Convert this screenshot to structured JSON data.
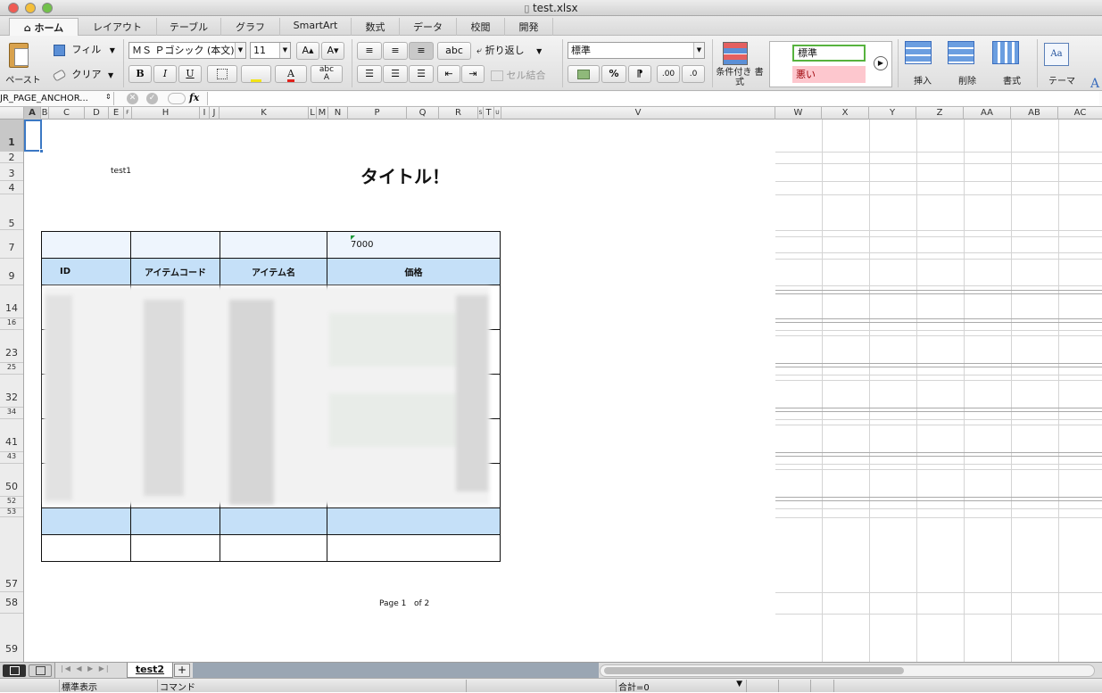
{
  "window": {
    "title": "test.xlsx"
  },
  "tabs": [
    "ホーム",
    "レイアウト",
    "テーブル",
    "グラフ",
    "SmartArt",
    "数式",
    "データ",
    "校閲",
    "開発"
  ],
  "ribbon": {
    "paste": "ペースト",
    "fill": "フィル",
    "clear": "クリア",
    "font_name": "ＭＳ Ｐゴシック (本文)",
    "font_size": "11",
    "bold": "B",
    "italic": "I",
    "underline": "U",
    "font_color_glyph": "A",
    "wrap": "折り返し",
    "merge": "セル結合",
    "abc": "abc",
    "number_format": "標準",
    "percent": "%",
    "comma": "⁋",
    "dec_inc": ".00",
    "dec_dec": ".0",
    "cond_format": "条件付き 書式",
    "style_normal": "標準",
    "style_bad": "悪い",
    "insert": "挿入",
    "delete": "削除",
    "format": "書式",
    "theme": "テーマ"
  },
  "formula_bar": {
    "name_box": "JR_PAGE_ANCHOR...",
    "fx": "fx",
    "value": ""
  },
  "columns": [
    "A",
    "B",
    "C",
    "D",
    "E",
    "F",
    "H",
    "I",
    "J",
    "K",
    "L",
    "M",
    "N",
    "P",
    "Q",
    "R",
    "S",
    "T",
    "U",
    "V",
    "W",
    "X",
    "Y",
    "Z",
    "AA",
    "AB",
    "AC"
  ],
  "rows": [
    "1",
    "2",
    "3",
    "4",
    "5",
    "7",
    "9",
    "14",
    "16",
    "23",
    "25",
    "32",
    "34",
    "41",
    "43",
    "50",
    "52",
    "53",
    "57",
    "58",
    "59"
  ],
  "sheet": {
    "cell_label": "test1",
    "title": "タイトル！",
    "total_value": "7000",
    "headers": [
      "ID",
      "アイテムコード",
      "アイテム名",
      "価格"
    ],
    "page_footer": "Page 1   of 2"
  },
  "sheet_tabs": [
    "test2"
  ],
  "status": {
    "view": "標準表示",
    "mode": "コマンド",
    "sum": "合計=0"
  },
  "colors": {
    "header_fill": "#c5e0f8",
    "light_fill": "#eef5fd",
    "accent": "#3b78c4"
  }
}
